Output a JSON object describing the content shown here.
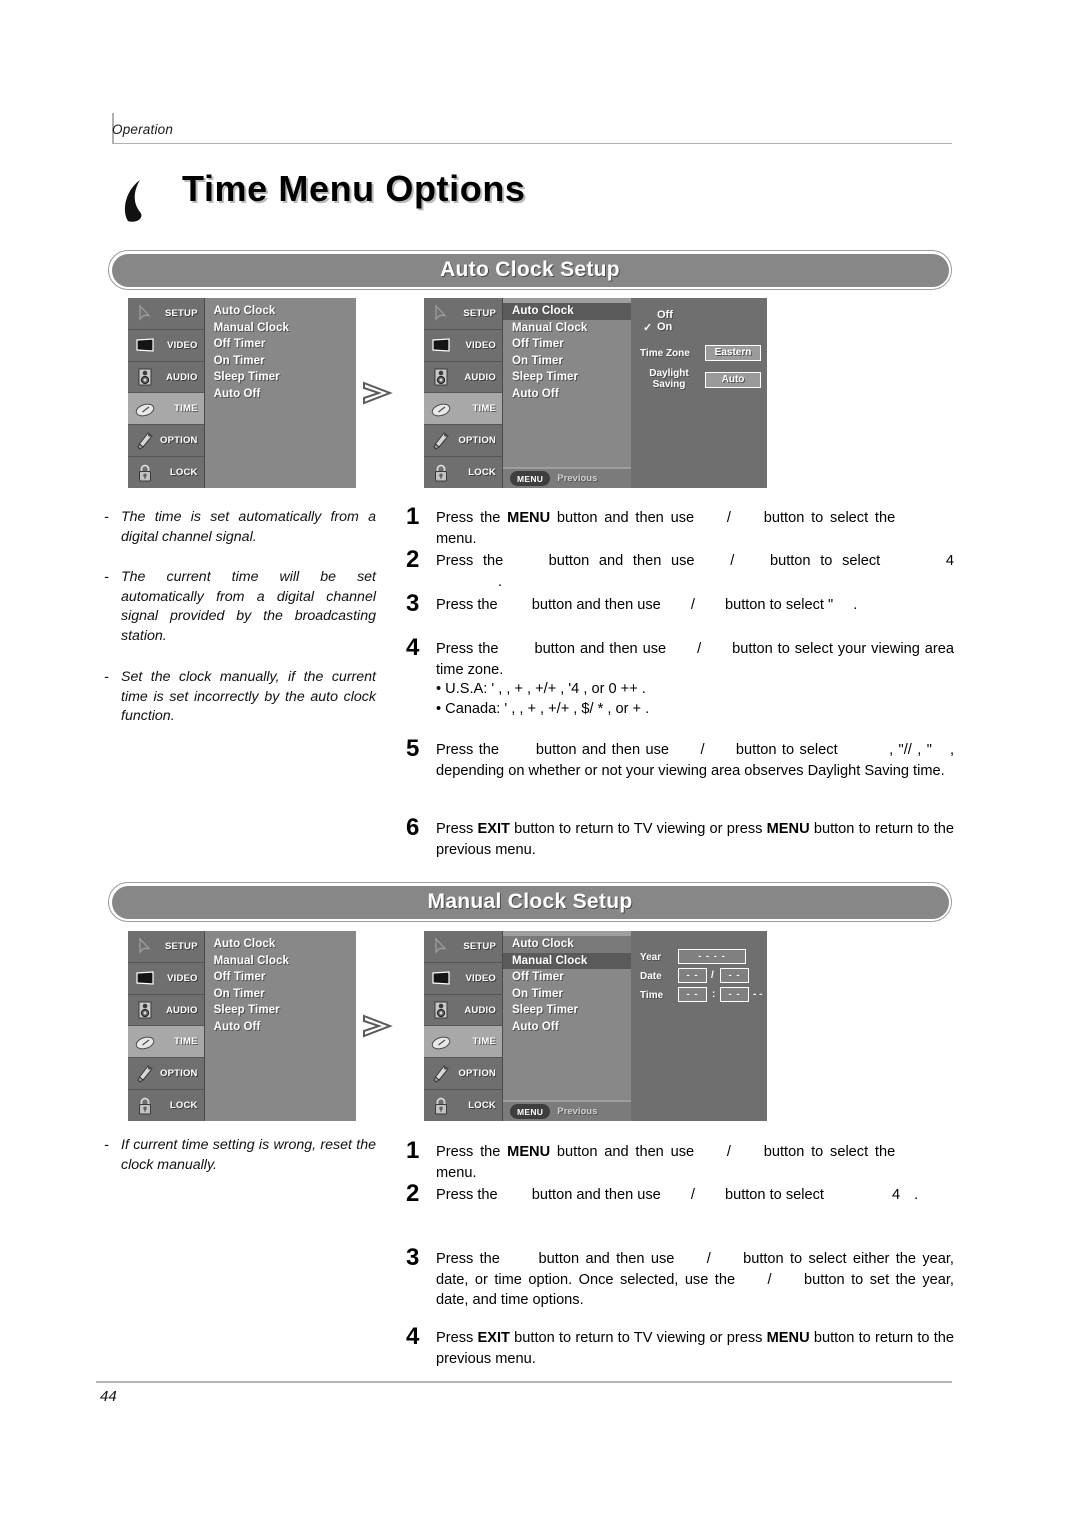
{
  "header": {
    "running_head": "Operation",
    "chapter_title": "Time Menu Options"
  },
  "sections": {
    "auto": {
      "banner": "Auto Clock Setup"
    },
    "manual": {
      "banner": "Manual Clock Setup"
    }
  },
  "osd": {
    "rail": [
      {
        "label": "SETUP",
        "icon": "cursor-arrow-icon",
        "active": false
      },
      {
        "label": "VIDEO",
        "icon": "tv-screen-icon",
        "active": false
      },
      {
        "label": "AUDIO",
        "icon": "speaker-icon",
        "active": false
      },
      {
        "label": "TIME",
        "icon": "clock-oval-icon",
        "active": true
      },
      {
        "label": "OPTION",
        "icon": "paintbrush-icon",
        "active": false
      },
      {
        "label": "LOCK",
        "icon": "padlock-icon",
        "active": false
      }
    ],
    "menu_items": [
      "Auto Clock",
      "Manual Clock",
      "Off Timer",
      "On Timer",
      "Sleep Timer",
      "Auto Off"
    ],
    "footer": {
      "menu_key": "MENU",
      "action": "Previous"
    },
    "auto_clock_detail": {
      "options": [
        "Off",
        "On"
      ],
      "checked_option": "On",
      "check_glyph": "✓",
      "time_zone_label": "Time Zone",
      "time_zone_value": "Eastern",
      "daylight_label_line1": "Daylight",
      "daylight_label_line2": "Saving",
      "daylight_value": "Auto"
    },
    "manual_clock_detail": {
      "year_label": "Year",
      "year_value": "- - - -",
      "date_label": "Date",
      "date_month": "- -",
      "date_sep": "/",
      "date_day": "- -",
      "time_label": "Time",
      "time_hour": "- -",
      "time_sep": ":",
      "time_min": "- -",
      "time_ampm": "- -"
    },
    "arrow_icon": "chevron-right-icon"
  },
  "notes_auto": [
    {
      "dash": "-",
      "text": "The time is set automatically from a digital channel signal."
    },
    {
      "dash": "-",
      "text": "The current time will be set automatically from a digital channel signal provided by the broadcasting station."
    },
    {
      "dash": "-",
      "text": "Set the clock manually, if the current time is set incorrectly by the auto clock function."
    }
  ],
  "notes_manual": [
    {
      "dash": "-",
      "text": "If current time setting is wrong, reset the clock manually."
    }
  ],
  "steps_auto": [
    {
      "num": "1",
      "parts": [
        {
          "t": "Press the "
        },
        {
          "t": "MENU",
          "b": true
        },
        {
          "t": " button and then use "
        },
        {
          "t": "",
          "gap": 26
        },
        {
          "t": "/"
        },
        {
          "t": "",
          "gap": 26
        },
        {
          "t": " button to select the "
        },
        {
          "t": "",
          "gap": 52
        },
        {
          "t": " menu."
        }
      ]
    },
    {
      "num": "2",
      "parts": [
        {
          "t": "Press the "
        },
        {
          "t": "",
          "gap": 26
        },
        {
          "t": " button and then use "
        },
        {
          "t": "",
          "gap": 26
        },
        {
          "t": "/"
        },
        {
          "t": "",
          "gap": 26
        },
        {
          "t": " button to select "
        },
        {
          "t": "",
          "gap": 56
        },
        {
          "t": "4"
        },
        {
          "t": "",
          "gap": 62
        },
        {
          "t": "."
        }
      ]
    },
    {
      "num": "3",
      "parts": [
        {
          "t": "Press the "
        },
        {
          "t": "",
          "gap": 26
        },
        {
          "t": " button and then use "
        },
        {
          "t": "",
          "gap": 26
        },
        {
          "t": "/"
        },
        {
          "t": "",
          "gap": 26
        },
        {
          "t": " button to select \""
        },
        {
          "t": "",
          "gap": 20
        },
        {
          "t": "."
        }
      ]
    },
    {
      "num": "4",
      "parts": [
        {
          "t": "Press the "
        },
        {
          "t": "",
          "gap": 26
        },
        {
          "t": " button and then use "
        },
        {
          "t": "",
          "gap": 26
        },
        {
          "t": "/"
        },
        {
          "t": "",
          "gap": 26
        },
        {
          "t": " button to select your viewing area time zone."
        }
      ],
      "bullets": [
        "• U.S.A:  '          ,            ,   +        ,  +/+   ,  '4       , or  0 ++    .",
        "• Canada:  '        ,           ,   +       ,   +/+   , $/ *  , or     +        ."
      ]
    },
    {
      "num": "5",
      "parts": [
        {
          "t": "Press the "
        },
        {
          "t": "",
          "gap": 26
        },
        {
          "t": " button and then use "
        },
        {
          "t": "",
          "gap": 26
        },
        {
          "t": "/"
        },
        {
          "t": "",
          "gap": 26
        },
        {
          "t": " button to select "
        },
        {
          "t": "",
          "gap": 46
        },
        {
          "t": ", \"//  , \""
        },
        {
          "t": "",
          "gap": 18
        },
        {
          "t": ", depending on whether or not your viewing area observes Daylight Saving time."
        }
      ]
    },
    {
      "num": "6",
      "parts": [
        {
          "t": "Press "
        },
        {
          "t": "EXIT",
          "b": true
        },
        {
          "t": " button to return to TV viewing or press "
        },
        {
          "t": "MENU",
          "b": true
        },
        {
          "t": " button to return to the previous menu."
        }
      ]
    }
  ],
  "steps_manual": [
    {
      "num": "1",
      "parts": [
        {
          "t": "Press the "
        },
        {
          "t": "MENU",
          "b": true
        },
        {
          "t": " button and then use "
        },
        {
          "t": "",
          "gap": 26
        },
        {
          "t": "/"
        },
        {
          "t": "",
          "gap": 26
        },
        {
          "t": " button to select the "
        },
        {
          "t": "",
          "gap": 52
        },
        {
          "t": " menu."
        }
      ]
    },
    {
      "num": "2",
      "parts": [
        {
          "t": "Press the "
        },
        {
          "t": "",
          "gap": 26
        },
        {
          "t": " button and then use "
        },
        {
          "t": "",
          "gap": 26
        },
        {
          "t": "/"
        },
        {
          "t": "",
          "gap": 26
        },
        {
          "t": " button to select "
        },
        {
          "t": "",
          "gap": 60
        },
        {
          "t": " 4"
        },
        {
          "t": "",
          "gap": 14
        },
        {
          "t": "."
        }
      ]
    },
    {
      "num": "3",
      "parts": [
        {
          "t": "Press the "
        },
        {
          "t": "",
          "gap": 26
        },
        {
          "t": " button and then use "
        },
        {
          "t": "",
          "gap": 26
        },
        {
          "t": "/"
        },
        {
          "t": "",
          "gap": 26
        },
        {
          "t": " button to select either the year, date, or time option. Once selected, use the "
        },
        {
          "t": "",
          "gap": 26
        },
        {
          "t": "/"
        },
        {
          "t": "",
          "gap": 26
        },
        {
          "t": " button to set the year, date, and time options."
        }
      ]
    },
    {
      "num": "4",
      "parts": [
        {
          "t": "Press "
        },
        {
          "t": "EXIT",
          "b": true
        },
        {
          "t": " button to return to TV viewing or press "
        },
        {
          "t": "MENU",
          "b": true
        },
        {
          "t": " button to return to the previous menu."
        }
      ]
    }
  ],
  "footer": {
    "page_number": "44"
  },
  "colors": {
    "osd_rail": "#6f6f6f",
    "osd_list": "#888888",
    "osd_selected": "#5a5a5a",
    "osd_active_tab": "#a8a8a8",
    "banner_fill": "#878787",
    "rule": "#b0b0b0"
  }
}
